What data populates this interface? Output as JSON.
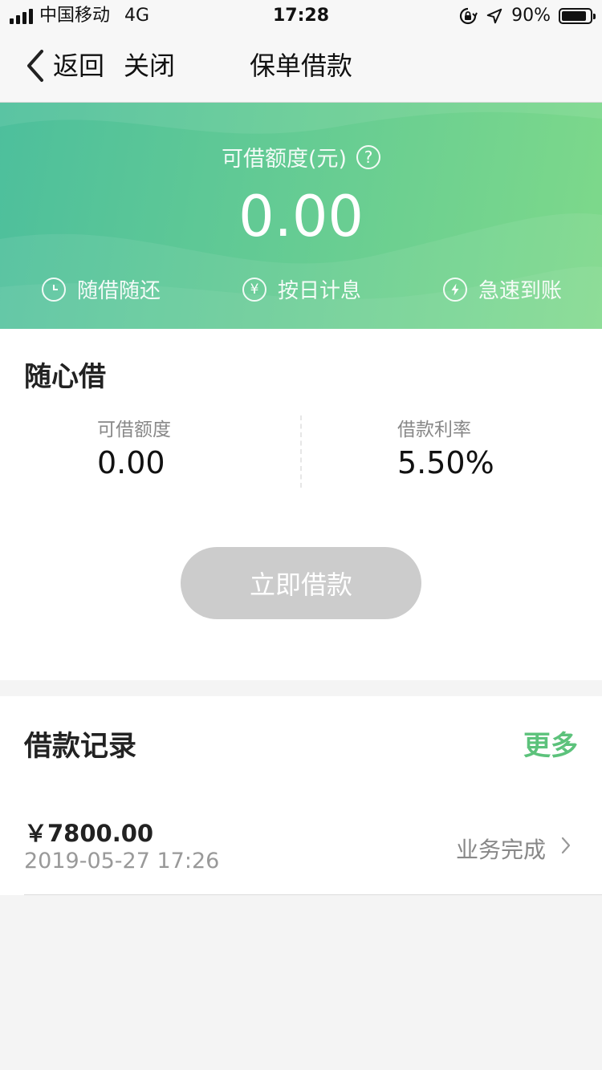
{
  "status_bar": {
    "carrier": "中国移动",
    "network": "4G",
    "time": "17:28",
    "battery_percent": "90%",
    "battery_level": 0.9
  },
  "nav": {
    "back_label": "返回",
    "close_label": "关闭",
    "title": "保单借款"
  },
  "hero": {
    "label": "可借额度(元)",
    "amount": "0.00",
    "features": [
      {
        "icon": "clock-icon",
        "label": "随借随还"
      },
      {
        "icon": "yen-icon",
        "label": "按日计息"
      },
      {
        "icon": "lightning-icon",
        "label": "急速到账"
      }
    ],
    "gradient_start": "#4dbf9c",
    "gradient_end": "#7ed98a"
  },
  "loan_card": {
    "title": "随心借",
    "credit_label": "可借额度",
    "credit_value": "0.00",
    "rate_label": "借款利率",
    "rate_value": "5.50%",
    "borrow_button": "立即借款"
  },
  "records": {
    "title": "借款记录",
    "more_label": "更多",
    "accent_color": "#5cc27b",
    "items": [
      {
        "amount": "￥7800.00",
        "date": "2019-05-27 17:26",
        "status": "业务完成"
      }
    ]
  }
}
